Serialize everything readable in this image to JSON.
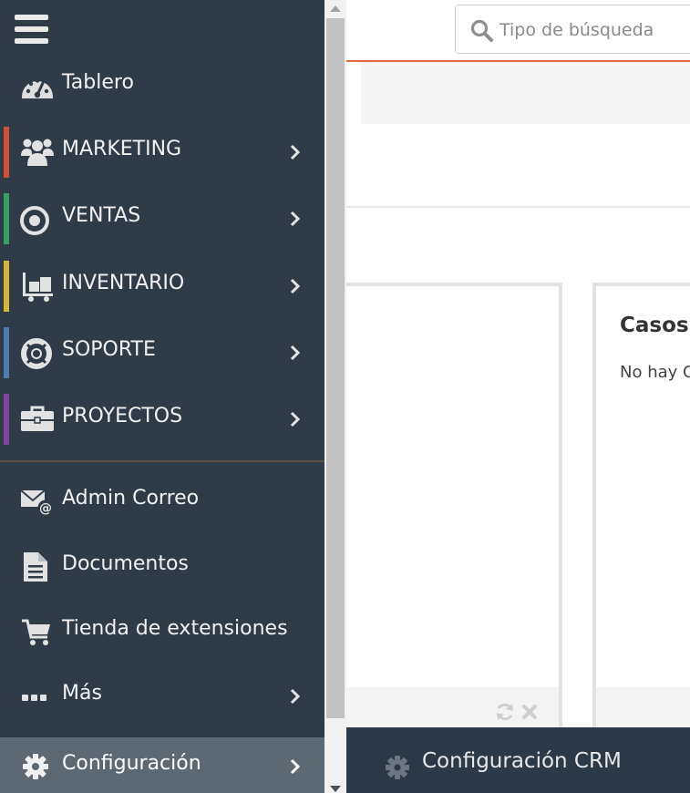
{
  "colors": {
    "sidebar_bg": "#2f3c48",
    "active_bg": "#5c6872",
    "accent_orange": "#e06b3c",
    "marketing": "#d1503a",
    "ventas": "#35a160",
    "inventario": "#d7b53c",
    "soporte": "#4f7bb0",
    "proyectos": "#7e44a0"
  },
  "search": {
    "placeholder": "Tipo de búsqueda",
    "icon": "search-icon"
  },
  "sidebar": {
    "menu_icon": "hamburger-icon",
    "items": [
      {
        "label": "Tablero",
        "icon": "dashboard-icon",
        "has_submenu": false
      },
      {
        "label": "MARKETING",
        "icon": "users-icon",
        "has_submenu": true,
        "color": "#d1503a"
      },
      {
        "label": "VENTAS",
        "icon": "target-icon",
        "has_submenu": true,
        "color": "#35a160"
      },
      {
        "label": "INVENTARIO",
        "icon": "dolly-icon",
        "has_submenu": true,
        "color": "#d7b53c"
      },
      {
        "label": "SOPORTE",
        "icon": "lifebuoy-icon",
        "has_submenu": true,
        "color": "#4f7bb0"
      },
      {
        "label": "PROYECTOS",
        "icon": "briefcase-icon",
        "has_submenu": true,
        "color": "#7e44a0"
      },
      {
        "label": "Admin Correo",
        "icon": "mail-at-icon",
        "has_submenu": false
      },
      {
        "label": "Documentos",
        "icon": "document-icon",
        "has_submenu": false
      },
      {
        "label": "Tienda de extensiones",
        "icon": "cart-icon",
        "has_submenu": false
      },
      {
        "label": "Más",
        "icon": "ellipsis-icon",
        "has_submenu": true
      },
      {
        "label": "Configuración",
        "icon": "gear-icon",
        "has_submenu": true,
        "active": true
      }
    ]
  },
  "widgets": [
    {
      "title": "",
      "text": "",
      "actions": [
        "refresh-icon",
        "close-icon"
      ]
    },
    {
      "title": "Casos",
      "text": "No hay C"
    }
  ],
  "footer": {
    "label": "Configuración CRM",
    "icon": "gear-icon"
  }
}
